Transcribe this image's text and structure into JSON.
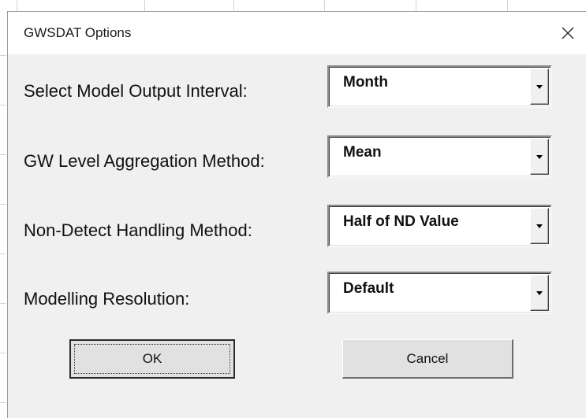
{
  "dialog": {
    "title": "GWSDAT Options",
    "close_symbol": "×"
  },
  "options": [
    {
      "label": "Select Model Output Interval:",
      "value": "Month"
    },
    {
      "label": "GW Level Aggregation Method:",
      "value": "Mean"
    },
    {
      "label": "Non-Detect Handling Method:",
      "value": "Half of ND Value"
    },
    {
      "label": "Modelling Resolution:",
      "value": "Default"
    }
  ],
  "buttons": {
    "ok_label": "OK",
    "cancel_label": "Cancel"
  },
  "colors": {
    "dialog_background": "#f0f0f0",
    "titlebar_background": "#ffffff",
    "button_face": "#e1e1e1"
  },
  "icons": {
    "close": "close-icon",
    "dropdown": "chevron-down-icon"
  }
}
